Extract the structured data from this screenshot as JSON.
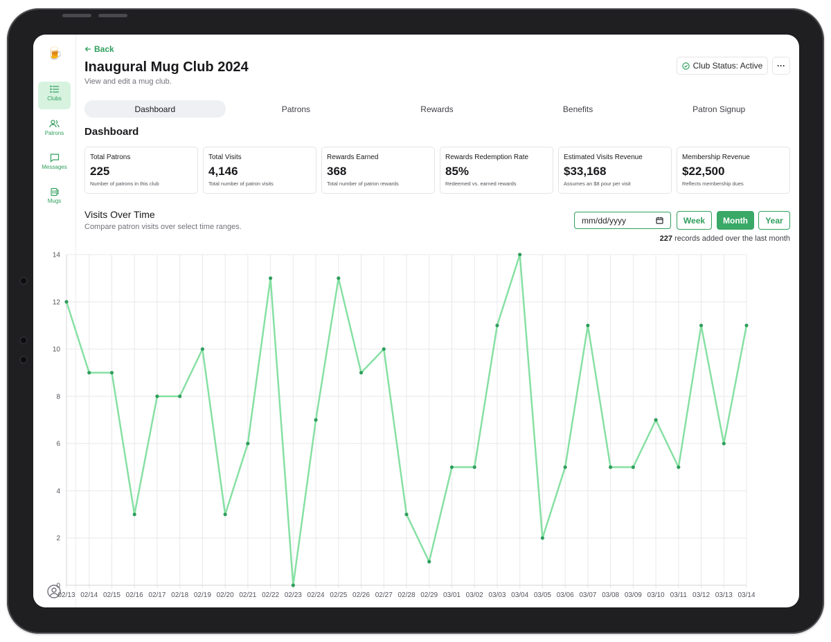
{
  "nav": {
    "logo": "🍺",
    "items": [
      {
        "label": "Clubs",
        "icon": "list-icon"
      },
      {
        "label": "Patrons",
        "icon": "users-icon"
      },
      {
        "label": "Messages",
        "icon": "message-icon"
      },
      {
        "label": "Mugs",
        "icon": "mug-icon"
      }
    ]
  },
  "header": {
    "back_label": "Back",
    "title": "Inaugural Mug Club 2024",
    "subtitle": "View and edit a mug club.",
    "status_label": "Club Status: Active",
    "more_label": "···"
  },
  "tabs": [
    "Dashboard",
    "Patrons",
    "Rewards",
    "Benefits",
    "Patron Signup"
  ],
  "section_title": "Dashboard",
  "stats": [
    {
      "label": "Total Patrons",
      "value": "225",
      "desc": "Number of patrons in this club"
    },
    {
      "label": "Total Visits",
      "value": "4,146",
      "desc": "Total number of patron visits"
    },
    {
      "label": "Rewards Earned",
      "value": "368",
      "desc": "Total number of patron rewards"
    },
    {
      "label": "Rewards Redemption Rate",
      "value": "85%",
      "desc": "Redeemed vs. earned rewards"
    },
    {
      "label": "Estimated Visits Revenue",
      "value": "$33,168",
      "desc": "Assumes an $8 pour per visit"
    },
    {
      "label": "Membership Revenue",
      "value": "$22,500",
      "desc": "Reflects membership dues"
    }
  ],
  "visits": {
    "title": "Visits Over Time",
    "subtitle": "Compare patron visits over select time ranges.",
    "date_placeholder": "mm/dd/yyyy",
    "ranges": [
      "Week",
      "Month",
      "Year"
    ],
    "active_range": "Month",
    "records_count": "227",
    "records_text": "records added over the last month"
  },
  "colors": {
    "accent": "#2f9e5c",
    "line": "#86e0a3",
    "point": "#2f9e5c"
  },
  "chart_data": {
    "type": "line",
    "title": "",
    "xlabel": "",
    "ylabel": "",
    "ylim": [
      0,
      14
    ],
    "yticks": [
      0,
      2,
      4,
      6,
      8,
      10,
      12,
      14
    ],
    "grid": true,
    "x": [
      "02/13",
      "02/14",
      "02/15",
      "02/16",
      "02/17",
      "02/18",
      "02/19",
      "02/20",
      "02/21",
      "02/22",
      "02/23",
      "02/24",
      "02/25",
      "02/26",
      "02/27",
      "02/28",
      "02/29",
      "03/01",
      "03/02",
      "03/03",
      "03/04",
      "03/05",
      "03/06",
      "03/07",
      "03/08",
      "03/09",
      "03/10",
      "03/11",
      "03/12",
      "03/13",
      "03/14"
    ],
    "series": [
      {
        "values": [
          12,
          9,
          9,
          3,
          8,
          8,
          10,
          3,
          6,
          13,
          0,
          7,
          13,
          9,
          10,
          3,
          1,
          5,
          5,
          11,
          14,
          2,
          5,
          11,
          5,
          5,
          7,
          5,
          11,
          6,
          11
        ]
      }
    ]
  }
}
